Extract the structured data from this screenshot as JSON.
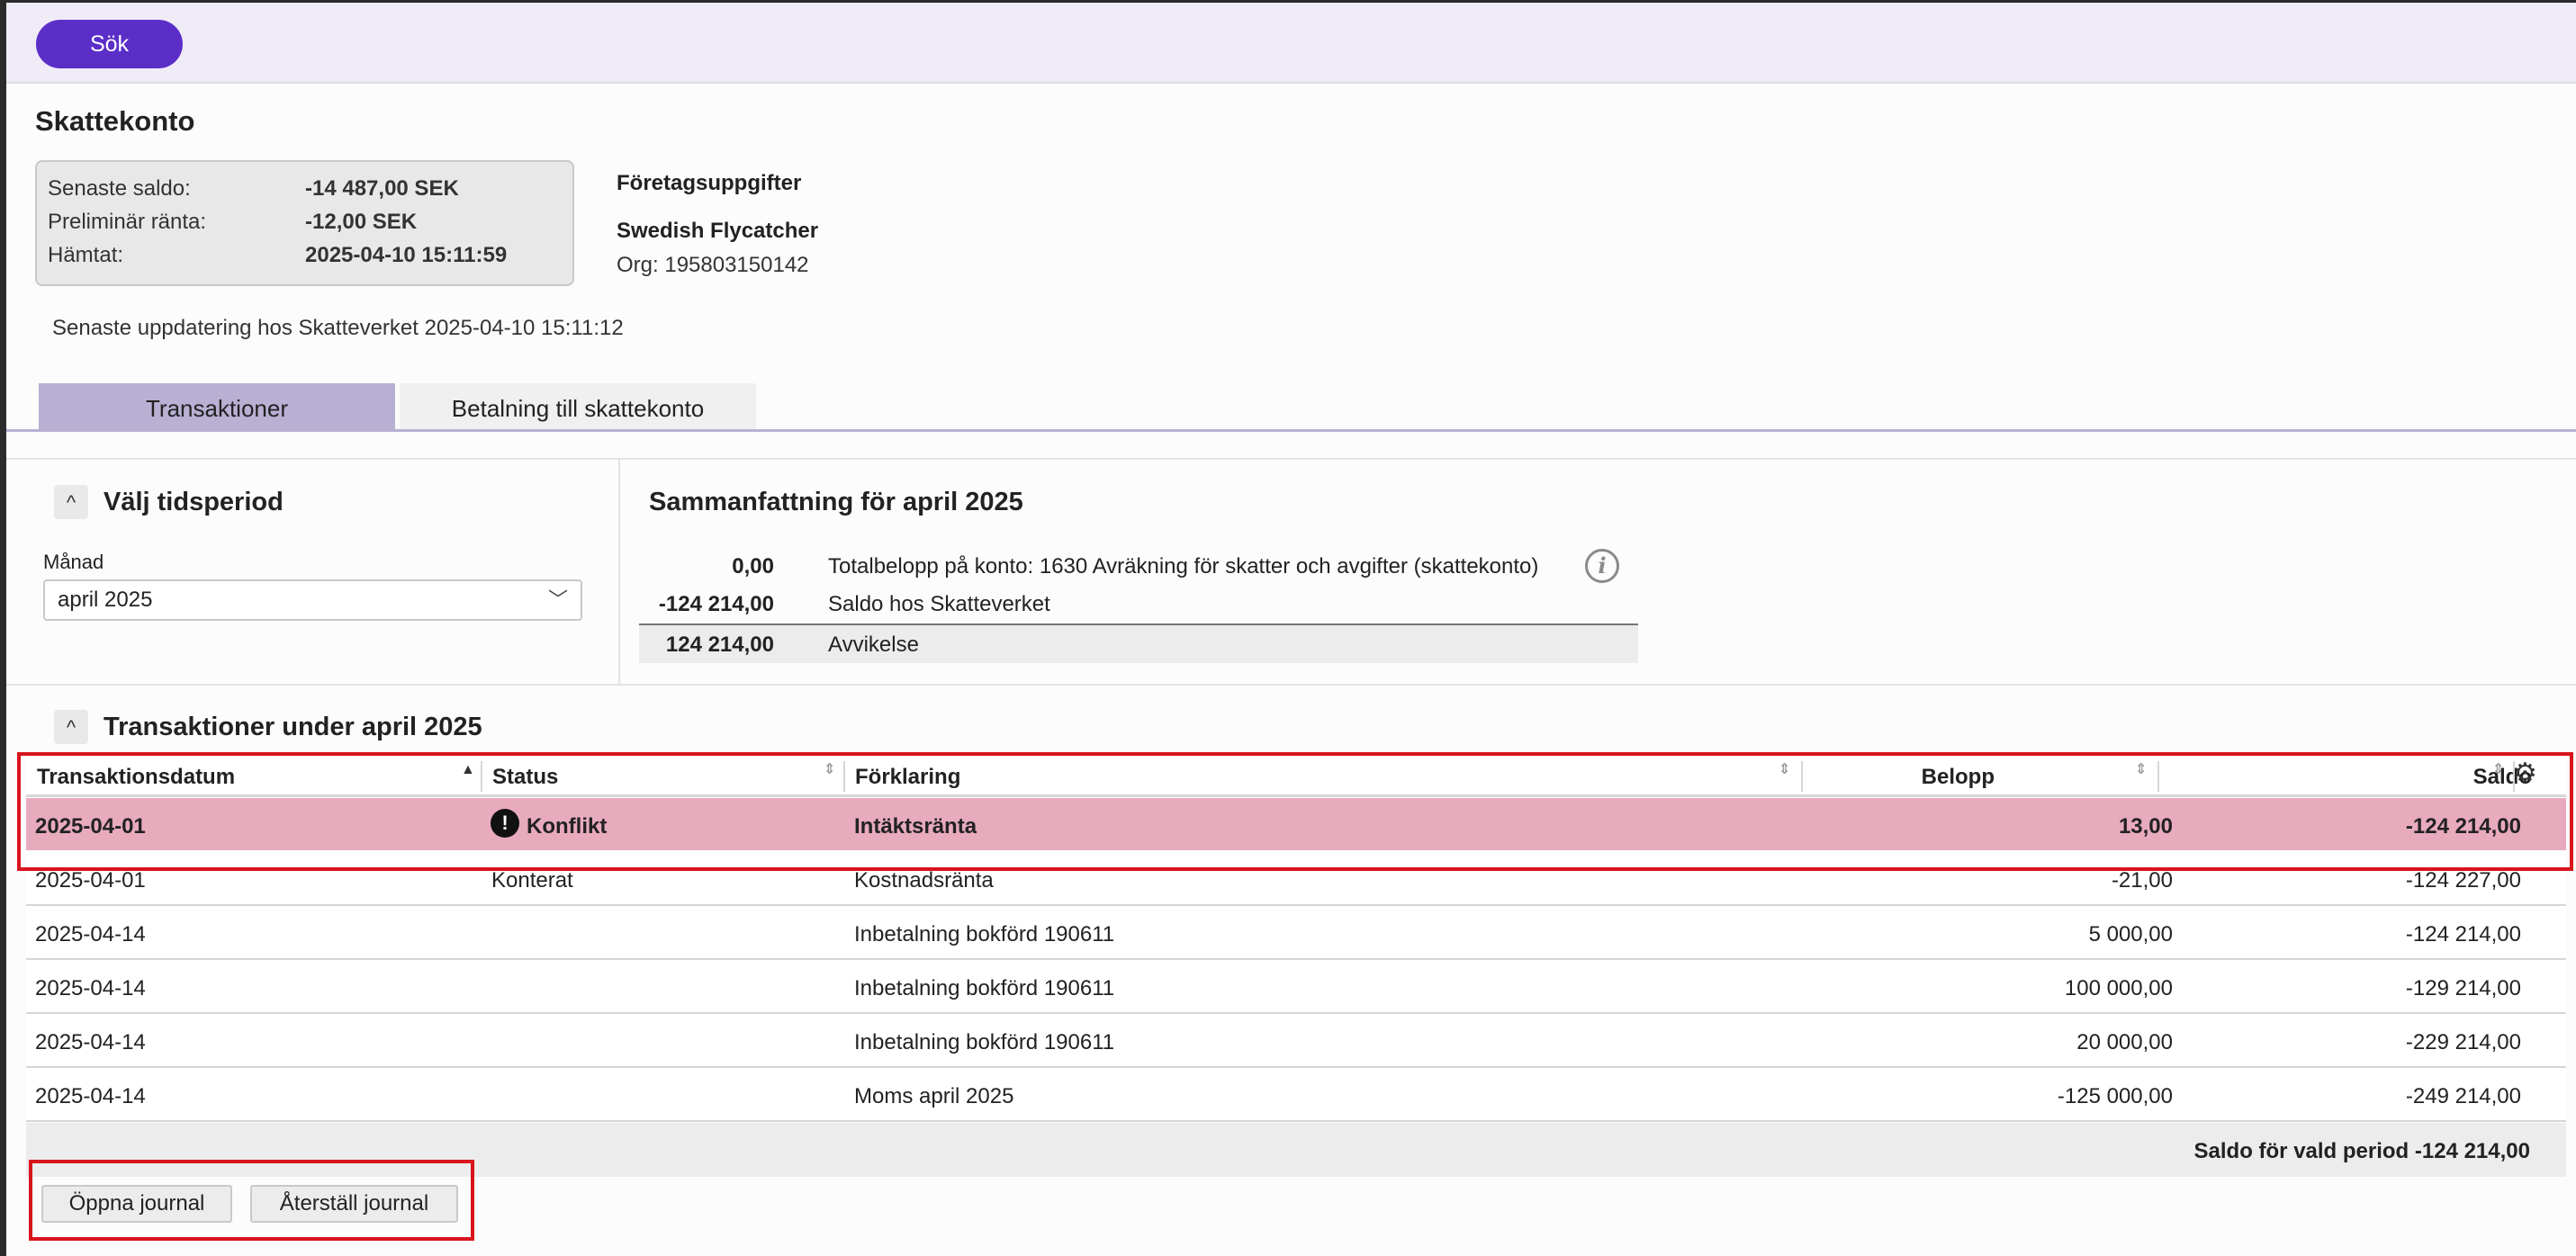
{
  "topbar": {
    "search_label": "Sök"
  },
  "page_title": "Skattekonto",
  "account_summary": {
    "rows": [
      {
        "label": "Senaste saldo:",
        "value": "-14 487,00 SEK"
      },
      {
        "label": "Preliminär ränta:",
        "value": "-12,00 SEK"
      },
      {
        "label": "Hämtat:",
        "value": "2025-04-10 15:11:59"
      }
    ]
  },
  "company": {
    "heading": "Företagsuppgifter",
    "name": "Swedish Flycatcher",
    "org": "Org: 195803150142"
  },
  "last_update": "Senaste uppdatering hos Skatteverket 2025-04-10 15:11:12",
  "tabs": [
    {
      "label": "Transaktioner",
      "active": true
    },
    {
      "label": "Betalning till skattekonto",
      "active": false
    }
  ],
  "period": {
    "title": "Välj tidsperiod",
    "month_label": "Månad",
    "month_value": "april 2025"
  },
  "summary": {
    "title": "Sammanfattning för april 2025",
    "rows": [
      {
        "amount": "0,00",
        "text": "Totalbelopp på konto: 1630 Avräkning för skatter och avgifter (skattekonto)"
      },
      {
        "amount": "-124 214,00",
        "text": "Saldo hos Skatteverket"
      },
      {
        "amount": "124 214,00",
        "text": "Avvikelse"
      }
    ]
  },
  "transactions": {
    "title": "Transaktioner under april 2025",
    "columns": [
      "Transaktionsdatum",
      "Status",
      "Förklaring",
      "Belopp",
      "Saldo"
    ],
    "rows": [
      {
        "date": "2025-04-01",
        "status": "Konflikt",
        "explanation": "Intäktsränta",
        "amount": "13,00",
        "balance": "-124 214,00"
      },
      {
        "date": "2025-04-01",
        "status": "Konterat",
        "explanation": "Kostnadsränta",
        "amount": "-21,00",
        "balance": "-124 227,00"
      },
      {
        "date": "2025-04-14",
        "status": "",
        "explanation": "Inbetalning bokförd 190611",
        "amount": "5 000,00",
        "balance": "-124 214,00"
      },
      {
        "date": "2025-04-14",
        "status": "",
        "explanation": "Inbetalning bokförd 190611",
        "amount": "100 000,00",
        "balance": "-129 214,00"
      },
      {
        "date": "2025-04-14",
        "status": "",
        "explanation": "Inbetalning bokförd 190611",
        "amount": "20 000,00",
        "balance": "-229 214,00"
      },
      {
        "date": "2025-04-14",
        "status": "",
        "explanation": "Moms april 2025",
        "amount": "-125 000,00",
        "balance": "-249 214,00"
      }
    ],
    "footer": "Saldo för vald period -124 214,00"
  },
  "buttons": {
    "open_journal": "Öppna journal",
    "reset_journal": "Återställ journal"
  },
  "colors": {
    "accent": "#5b2ec8",
    "tab_active": "#b9b0d4",
    "conflict_row": "#e8aabd",
    "highlight": "#d8141c"
  }
}
